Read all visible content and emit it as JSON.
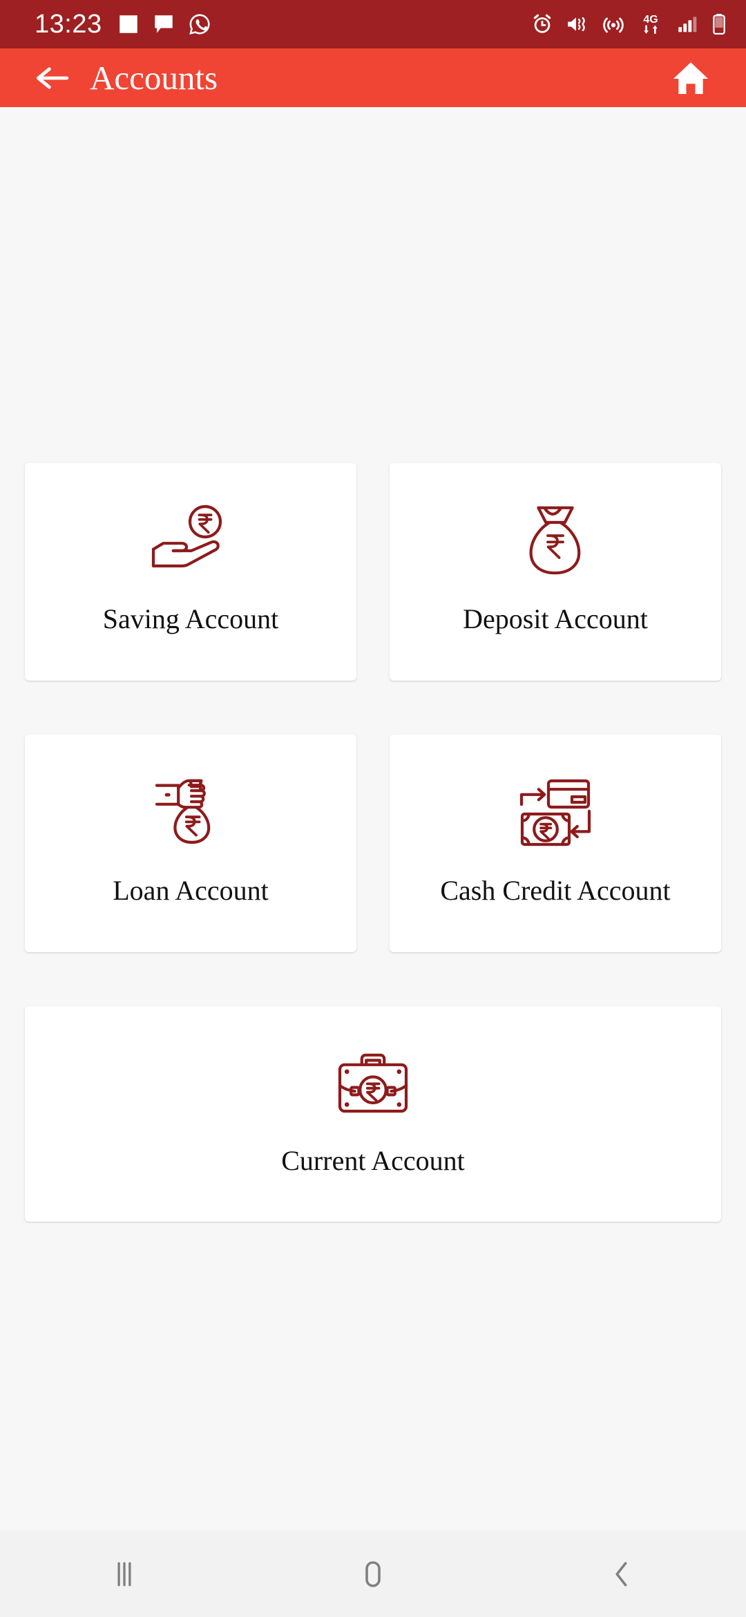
{
  "status_bar": {
    "time": "13:23",
    "left_icons": [
      "gallery-icon",
      "message-icon",
      "whatsapp-icon"
    ],
    "right_icons": [
      "alarm-icon",
      "mute-vibrate-icon",
      "hotspot-icon",
      "network-4g-icon",
      "signal-icon",
      "battery-icon"
    ],
    "network_label": "4G",
    "background_color": "#9e2022"
  },
  "app_bar": {
    "back_icon": "arrow-left-icon",
    "title": "Accounts",
    "home_icon": "home-icon",
    "background_color": "#f04434",
    "text_color": "#ffffff"
  },
  "page": {
    "background_color": "#f7f7f7",
    "icon_color": "#8e1b1b",
    "label_color": "#111111"
  },
  "accounts": {
    "rows": [
      [
        {
          "label": "Saving Account",
          "icon": "hand-holding-rupee-coin-icon"
        },
        {
          "label": "Deposit Account",
          "icon": "money-bag-rupee-icon"
        }
      ],
      [
        {
          "label": "Loan Account",
          "icon": "hand-grabbing-money-bag-icon"
        },
        {
          "label": "Cash Credit Account",
          "icon": "card-banknote-exchange-icon"
        }
      ]
    ],
    "full_width": {
      "label": "Current Account",
      "icon": "briefcase-rupee-icon"
    }
  },
  "nav_bar": {
    "recents_icon": "recents-icon",
    "home_icon": "nav-home-icon",
    "back_icon": "nav-back-icon",
    "background_color": "#f2f2f2"
  }
}
